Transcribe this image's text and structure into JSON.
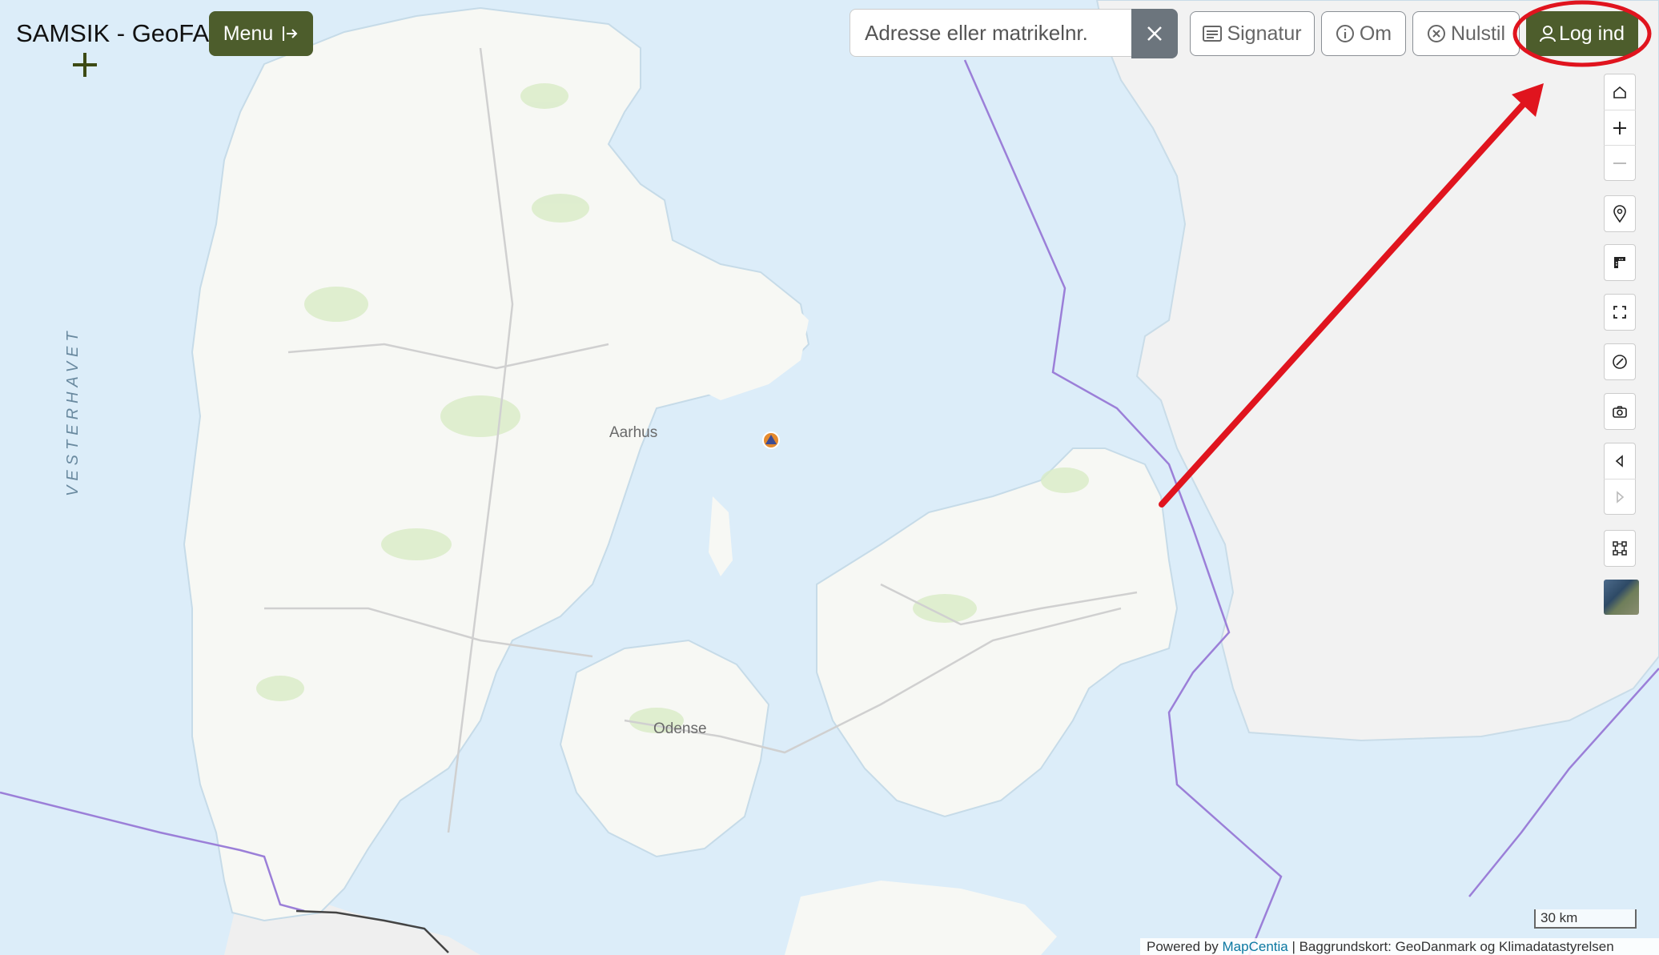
{
  "app": {
    "title": "SAMSIK - GeoFA"
  },
  "toolbar": {
    "menu_label": "Menu",
    "search_placeholder": "Adresse eller matrikelnr.",
    "signatur_label": "Signatur",
    "om_label": "Om",
    "nulstil_label": "Nulstil",
    "login_label": "Log ind"
  },
  "map": {
    "labels": {
      "sea": "VESTERHAVET",
      "city_aarhus": "Aarhus",
      "city_odense": "Odense"
    },
    "scale": "30 km"
  },
  "attribution": {
    "prefix": "Powered by",
    "link": "MapCentia",
    "suffix": " | Baggrundskort: GeoDanmark og Klimadatastyrelsen"
  },
  "colors": {
    "accent": "#4d5d2c",
    "annotation": "#e0141e",
    "water": "#dcedf9",
    "land": "#f7f8f4",
    "foreign_land": "#f2f2f2"
  },
  "controls": [
    "home-icon",
    "zoom-in-icon",
    "zoom-out-icon",
    "location-pin-icon",
    "measure-icon",
    "fullscreen-icon",
    "compass-icon",
    "camera-icon",
    "back-icon",
    "forward-icon",
    "draw-icon",
    "satellite-layer"
  ]
}
